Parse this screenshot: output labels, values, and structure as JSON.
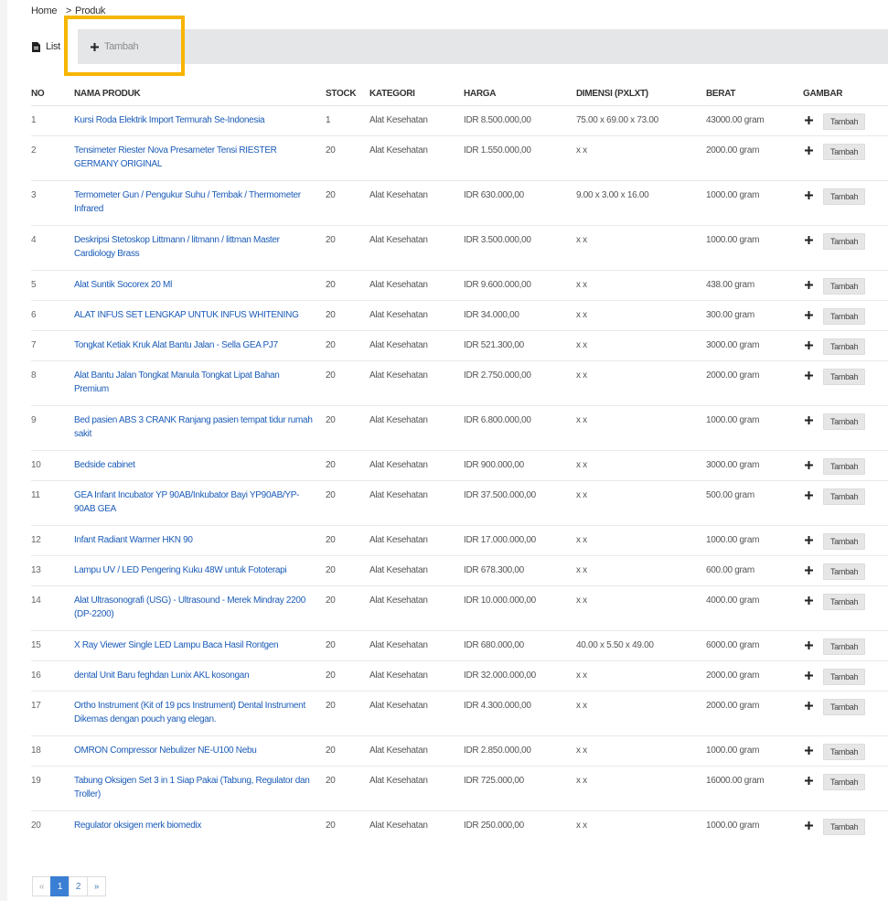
{
  "breadcrumb": {
    "home": "Home",
    "separator": ">",
    "current": "Produk"
  },
  "tabs": {
    "list_label": "List",
    "add_label": "Tambah"
  },
  "table": {
    "headers": [
      "NO",
      "NAMA PRODUK",
      "STOCK",
      "KATEGORI",
      "HARGA",
      "DIMENSI (PXLXT)",
      "BERAT",
      "GAMBAR"
    ],
    "rows": [
      {
        "no": "1",
        "name": "Kursi Roda Elektrik Import Termurah Se-Indonesia",
        "stock": "1",
        "kategori": "Alat Kesehatan",
        "harga": "IDR 8.500.000,00",
        "dimensi": "75.00 x 69.00 x 73.00",
        "berat": "43000.00 gram",
        "gambar": "Tambah",
        "lines": 1
      },
      {
        "no": "2",
        "name": "Tensimeter Riester Nova Presameter Tensi RIESTER GERMANY ORIGINAL",
        "stock": "20",
        "kategori": "Alat Kesehatan",
        "harga": "IDR 1.550.000,00",
        "dimensi": "x x",
        "berat": "2000.00 gram",
        "gambar": "Tambah",
        "lines": 2
      },
      {
        "no": "3",
        "name": "Termometer Gun / Pengukur Suhu / Tembak / Thermometer Infrared",
        "stock": "20",
        "kategori": "Alat Kesehatan",
        "harga": "IDR 630.000,00",
        "dimensi": "9.00 x 3.00 x 16.00",
        "berat": "1000.00 gram",
        "gambar": "Tambah",
        "lines": 2
      },
      {
        "no": "4",
        "name": "Deskripsi Stetoskop Littmann / litmann / littman Master Cardiology Brass",
        "stock": "20",
        "kategori": "Alat Kesehatan",
        "harga": "IDR 3.500.000,00",
        "dimensi": "x x",
        "berat": "1000.00 gram",
        "gambar": "Tambah",
        "lines": 2
      },
      {
        "no": "5",
        "name": "Alat Suntik Socorex 20 Ml",
        "stock": "20",
        "kategori": "Alat Kesehatan",
        "harga": "IDR 9.600.000,00",
        "dimensi": "x x",
        "berat": "438.00 gram",
        "gambar": "Tambah",
        "lines": 1
      },
      {
        "no": "6",
        "name": "ALAT INFUS SET LENGKAP UNTUK INFUS WHITENING",
        "stock": "20",
        "kategori": "Alat Kesehatan",
        "harga": "IDR 34.000,00",
        "dimensi": "x x",
        "berat": "300.00 gram",
        "gambar": "Tambah",
        "lines": 1
      },
      {
        "no": "7",
        "name": "Tongkat Ketiak Kruk Alat Bantu Jalan - Sella GEA PJ7",
        "stock": "20",
        "kategori": "Alat Kesehatan",
        "harga": "IDR 521.300,00",
        "dimensi": "x x",
        "berat": "3000.00 gram",
        "gambar": "Tambah",
        "lines": 1
      },
      {
        "no": "8",
        "name": "Alat Bantu Jalan Tongkat Manula Tongkat Lipat Bahan Premium",
        "stock": "20",
        "kategori": "Alat Kesehatan",
        "harga": "IDR 2.750.000,00",
        "dimensi": "x x",
        "berat": "2000.00 gram",
        "gambar": "Tambah",
        "lines": 2
      },
      {
        "no": "9",
        "name": "Bed pasien ABS 3 CRANK Ranjang pasien tempat tidur rumah sakit",
        "stock": "20",
        "kategori": "Alat Kesehatan",
        "harga": "IDR 6.800.000,00",
        "dimensi": "x x",
        "berat": "1000.00 gram",
        "gambar": "Tambah",
        "lines": 2
      },
      {
        "no": "10",
        "name": "Bedside cabinet",
        "stock": "20",
        "kategori": "Alat Kesehatan",
        "harga": "IDR 900.000,00",
        "dimensi": "x x",
        "berat": "3000.00 gram",
        "gambar": "Tambah",
        "lines": 1
      },
      {
        "no": "11",
        "name": "GEA Infant Incubator YP 90AB/Inkubator Bayi YP90AB/YP-90AB GEA",
        "stock": "20",
        "kategori": "Alat Kesehatan",
        "harga": "IDR 37.500.000,00",
        "dimensi": "x x",
        "berat": "500.00 gram",
        "gambar": "Tambah",
        "lines": 2
      },
      {
        "no": "12",
        "name": "Infant Radiant Warmer HKN 90",
        "stock": "20",
        "kategori": "Alat Kesehatan",
        "harga": "IDR 17.000.000,00",
        "dimensi": "x x",
        "berat": "1000.00 gram",
        "gambar": "Tambah",
        "lines": 1
      },
      {
        "no": "13",
        "name": "Lampu UV / LED Pengering Kuku 48W untuk Fototerapi",
        "stock": "20",
        "kategori": "Alat Kesehatan",
        "harga": "IDR 678.300,00",
        "dimensi": "x x",
        "berat": "600.00 gram",
        "gambar": "Tambah",
        "lines": 1
      },
      {
        "no": "14",
        "name": "Alat Ultrasonografi (USG) - Ultrasound - Merek Mindray 2200 (DP-2200)",
        "stock": "20",
        "kategori": "Alat Kesehatan",
        "harga": "IDR 10.000.000,00",
        "dimensi": "x x",
        "berat": "4000.00 gram",
        "gambar": "Tambah",
        "lines": 2
      },
      {
        "no": "15",
        "name": "X Ray Viewer Single LED Lampu Baca Hasil Rontgen",
        "stock": "20",
        "kategori": "Alat Kesehatan",
        "harga": "IDR 680.000,00",
        "dimensi": "40.00 x 5.50 x 49.00",
        "berat": "6000.00 gram",
        "gambar": "Tambah",
        "lines": 1
      },
      {
        "no": "16",
        "name": "dental Unit Baru feghdan Lunix AKL kosongan",
        "stock": "20",
        "kategori": "Alat Kesehatan",
        "harga": "IDR 32.000.000,00",
        "dimensi": "x x",
        "berat": "2000.00 gram",
        "gambar": "Tambah",
        "lines": 1
      },
      {
        "no": "17",
        "name": "Ortho Instrument (Kit of 19 pcs Instrument) Dental Instrument Dikemas dengan pouch yang elegan.",
        "stock": "20",
        "kategori": "Alat Kesehatan",
        "harga": "IDR 4.300.000,00",
        "dimensi": "x x",
        "berat": "2000.00 gram",
        "gambar": "Tambah",
        "lines": 2
      },
      {
        "no": "18",
        "name": "OMRON Compressor Nebulizer NE-U100 Nebu",
        "stock": "20",
        "kategori": "Alat Kesehatan",
        "harga": "IDR 2.850.000,00",
        "dimensi": "x x",
        "berat": "1000.00 gram",
        "gambar": "Tambah",
        "lines": 1
      },
      {
        "no": "19",
        "name": "Tabung Oksigen Set 3 in 1 Siap Pakai (Tabung, Regulator dan Troller)",
        "stock": "20",
        "kategori": "Alat Kesehatan",
        "harga": "IDR 725.000,00",
        "dimensi": "x x",
        "berat": "16000.00 gram",
        "gambar": "Tambah",
        "lines": 2
      },
      {
        "no": "20",
        "name": "Regulator oksigen merk biomedix",
        "stock": "20",
        "kategori": "Alat Kesehatan",
        "harga": "IDR 250.000,00",
        "dimensi": "x x",
        "berat": "1000.00 gram",
        "gambar": "Tambah",
        "lines": 1
      }
    ]
  },
  "pagination": {
    "prev": "«",
    "pages": [
      "1",
      "2"
    ],
    "active": "1",
    "next": "»"
  },
  "colors": {
    "link": "#1a5bb8",
    "highlight": "#f7b500",
    "active_page": "#3b7fd4",
    "tabbar": "#e4e6e8"
  },
  "icons": {
    "list_tab": "file-icon",
    "add_tab": "plus-icon",
    "gambar": "plus-icon"
  }
}
